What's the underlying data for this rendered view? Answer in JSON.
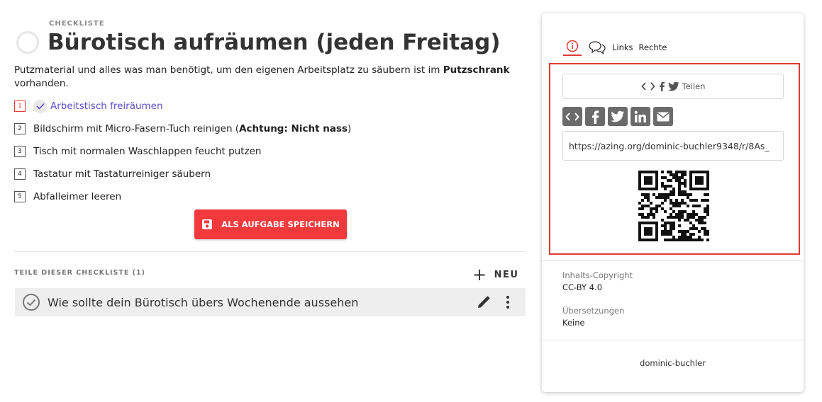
{
  "checklist": {
    "kicker": "CHECKLISTE",
    "title": "Bürotisch aufräumen (jeden Freitag)",
    "description_part1": "Putzmaterial und alles was man benötigt, um den eigenen Arbeitsplatz zu säubern ist im ",
    "description_bold": "Putzschrank",
    "description_part2": " vorhanden."
  },
  "steps": [
    {
      "number": "1",
      "text": "Arbeitstisch freiräumen",
      "done": true
    },
    {
      "number": "2",
      "text_part1": "Bildschirm mit Micro-Fasern-Tuch reinigen (",
      "text_bold": "Achtung: Nicht nass",
      "text_part2": ")"
    },
    {
      "number": "3",
      "text": "Tisch mit normalen Waschlappen feucht putzen"
    },
    {
      "number": "4",
      "text": "Tastatur mit Tastaturreiniger säubern"
    },
    {
      "number": "5",
      "text": "Abfalleimer leeren"
    }
  ],
  "save_button_label": "ALS AUFGABE SPEICHERN",
  "parts": {
    "label": "TEILE DIESER CHECKLISTE (1)",
    "new_label": "NEU",
    "items": [
      {
        "text": "Wie sollte dein Bürotisch übers Wochenende aussehen"
      }
    ]
  },
  "panel": {
    "tabs": {
      "info_icon": "info-icon",
      "comments_icon": "comments-icon",
      "links": "Links",
      "rights": "Rechte"
    },
    "share": {
      "button_label": "Teilen",
      "icons": [
        "embed-icon",
        "facebook-icon",
        "twitter-icon",
        "linkedin-icon",
        "email-icon"
      ],
      "url": "https://azing.org/dominic-buchler9348/r/8As_"
    },
    "copyright_label": "Inhalts-Copyright",
    "copyright_value": "CC-BY 4.0",
    "translations_label": "Übersetzungen",
    "translations_value": "Keine",
    "owner": "dominic-buchler"
  },
  "colors": {
    "accent_red": "#f23a3c",
    "done_purple": "#5b4fc9",
    "icon_gray": "#6b6b6b"
  }
}
